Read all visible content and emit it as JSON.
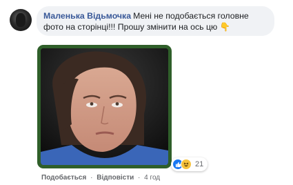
{
  "comment": {
    "author": "Маленька Відьмочка",
    "text": "Мені не подобається головне фото на сторінці!!! Прошу змінити на ось цю",
    "emoji": "👇"
  },
  "attached_image": {
    "alt": "photo"
  },
  "reactions": {
    "icons": [
      "like-icon",
      "haha-icon"
    ],
    "count": "21"
  },
  "actions": {
    "like_label": "Подобається",
    "separator": "·",
    "reply_label": "Відповісти",
    "time": "4 год"
  },
  "colors": {
    "author": "#385898",
    "bubble_bg": "#f0f2f5",
    "image_border": "#2f5f2a",
    "like": "#1877f2",
    "haha": "#f7c33d"
  }
}
